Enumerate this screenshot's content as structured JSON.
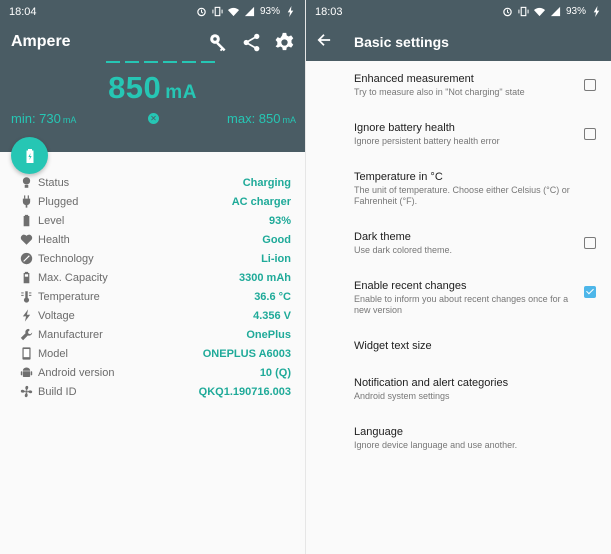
{
  "left": {
    "status": {
      "time": "18:04",
      "battery": "93%"
    },
    "app_title": "Ampere",
    "current": {
      "value": "850",
      "unit": "mA"
    },
    "min": {
      "label": "min: 730",
      "unit": "mA"
    },
    "max": {
      "label": "max: 850",
      "unit": "mA"
    },
    "stats": [
      {
        "icon": "bulb-icon",
        "label": "Status",
        "value": "Charging"
      },
      {
        "icon": "plug-icon",
        "label": "Plugged",
        "value": "AC charger"
      },
      {
        "icon": "battery-icon",
        "label": "Level",
        "value": "93%"
      },
      {
        "icon": "heart-icon",
        "label": "Health",
        "value": "Good"
      },
      {
        "icon": "technology-icon",
        "label": "Technology",
        "value": "Li-ion"
      },
      {
        "icon": "battery-capacity-icon",
        "label": "Max. Capacity",
        "value": "3300 mAh"
      },
      {
        "icon": "thermometer-icon",
        "label": "Temperature",
        "value": "36.6 °C"
      },
      {
        "icon": "bolt-icon",
        "label": "Voltage",
        "value": "4.356 V"
      },
      {
        "icon": "wrench-icon",
        "label": "Manufacturer",
        "value": "OnePlus"
      },
      {
        "icon": "phone-icon",
        "label": "Model",
        "value": "ONEPLUS A6003"
      },
      {
        "icon": "android-icon",
        "label": "Android version",
        "value": "10 (Q)"
      },
      {
        "icon": "fan-icon",
        "label": "Build ID",
        "value": "QKQ1.190716.003"
      }
    ]
  },
  "right": {
    "status": {
      "time": "18:03",
      "battery": "93%"
    },
    "title": "Basic settings",
    "settings": [
      {
        "title": "Enhanced measurement",
        "subtitle": "Try to measure also in \"Not charging\" state",
        "checkbox": true,
        "checked": false
      },
      {
        "title": "Ignore battery health",
        "subtitle": "Ignore persistent battery health error",
        "checkbox": true,
        "checked": false
      },
      {
        "title": "Temperature in °C",
        "subtitle": "The unit of temperature. Choose either Celsius (°C) or Fahrenheit (°F).",
        "checkbox": false
      },
      {
        "title": "Dark theme",
        "subtitle": "Use dark colored theme.",
        "checkbox": true,
        "checked": false
      },
      {
        "title": "Enable recent changes",
        "subtitle": "Enable to inform you about recent changes once for a new version",
        "checkbox": true,
        "checked": true
      },
      {
        "title": "Widget text size",
        "subtitle": "",
        "checkbox": false
      },
      {
        "title": "Notification and alert categories",
        "subtitle": "Android system settings",
        "checkbox": false
      },
      {
        "title": "Language",
        "subtitle": "Ignore device language and use another.",
        "checkbox": false
      }
    ]
  },
  "colors": {
    "toolbar": "#4a5c64",
    "accent": "#26c6b4",
    "value": "#1faa99",
    "checkbox_on": "#4db6e9"
  }
}
